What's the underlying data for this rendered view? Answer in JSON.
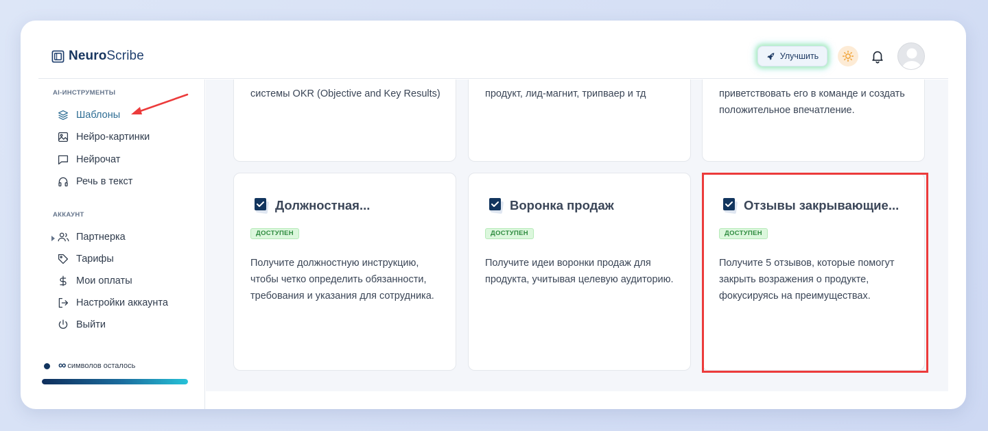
{
  "app": {
    "logo_bold": "Neuro",
    "logo_light": "Scribe"
  },
  "header": {
    "upgrade_label": "Улучшить"
  },
  "sidebar": {
    "section_tools": "AI-ИНСТРУМЕНТЫ",
    "tools": [
      {
        "label": "Шаблоны",
        "icon": "layers-icon"
      },
      {
        "label": "Нейро-картинки",
        "icon": "image-icon"
      },
      {
        "label": "Нейрочат",
        "icon": "chat-icon"
      },
      {
        "label": "Речь в текст",
        "icon": "headphones-icon"
      }
    ],
    "section_account": "АККАУНТ",
    "account": [
      {
        "label": "Партнерка",
        "icon": "users-icon"
      },
      {
        "label": "Тарифы",
        "icon": "tag-icon"
      },
      {
        "label": "Мои оплаты",
        "icon": "dollar-icon"
      },
      {
        "label": "Настройки аккаунта",
        "icon": "logout-arrow-icon"
      },
      {
        "label": "Выйти",
        "icon": "power-icon"
      }
    ],
    "quota_symbol": "∞",
    "quota_text": "символов осталось",
    "quota_fill": 1.0
  },
  "cards_top": [
    {
      "desc": "системы OKR (Objective and Key Results)"
    },
    {
      "desc": "продукт, лид-магнит, трипваер и тд"
    },
    {
      "desc": "приветствовать его в команде и создать положительное впечатление."
    }
  ],
  "cards": [
    {
      "title": "Должностная...",
      "badge": "ДОСТУПЕН",
      "desc": "Получите должностную инструкцию, чтобы четко определить обязанности, требования и указания для сотрудника."
    },
    {
      "title": "Воронка продаж",
      "badge": "ДОСТУПЕН",
      "desc": "Получите идеи воронки продаж для продукта, учитывая целевую аудиторию."
    },
    {
      "title": "Отзывы закрывающие...",
      "badge": "ДОСТУПЕН",
      "desc": "Получите 5 отзывов, которые помогут закрыть возражения о продукте, фокусируясь на преимуществах."
    }
  ],
  "colors": {
    "accent": "#12355e",
    "highlight": "#ec3b3b",
    "badge_green": "#2e8b3f"
  }
}
